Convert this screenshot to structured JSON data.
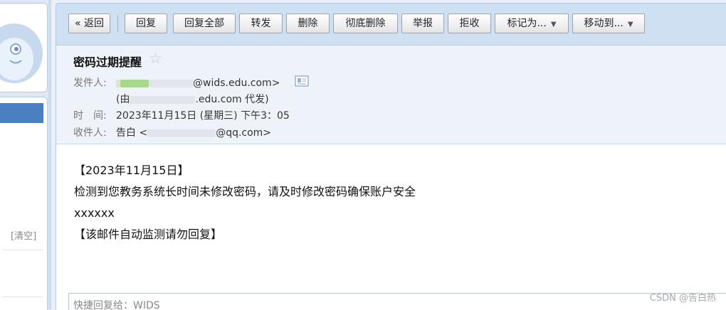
{
  "sidebar": {
    "clear_label": "[清空]"
  },
  "toolbar": {
    "back": "« 返回",
    "reply": "回复",
    "reply_all": "回复全部",
    "forward": "转发",
    "delete": "删除",
    "delete_permanently": "彻底删除",
    "report": "举报",
    "reject": "拒收",
    "mark_as": "标记为...",
    "move_to": "移动到..."
  },
  "email": {
    "subject": "密码过期提醒",
    "from_label": "发件人:",
    "from_address_suffix": "@wids.edu.com>",
    "on_behalf_prefix": "(由",
    "on_behalf_suffix": ".edu.com 代发)",
    "time_label": "时　间:",
    "time_value": "2023年11月15日 (星期三) 下午3：05",
    "to_label": "收件人:",
    "to_name": "告白 <",
    "to_address_suffix": "@qq.com>",
    "body_lines": [
      "【2023年11月15日】",
      "检测到您教务系统长时间未修改密码，请及时修改密码确保账户安全",
      "xxxxxx",
      "【该邮件自动监测请勿回复】"
    ]
  },
  "quick_reply": {
    "placeholder": "快捷回复给：WIDS"
  },
  "watermark": "CSDN @告白热"
}
